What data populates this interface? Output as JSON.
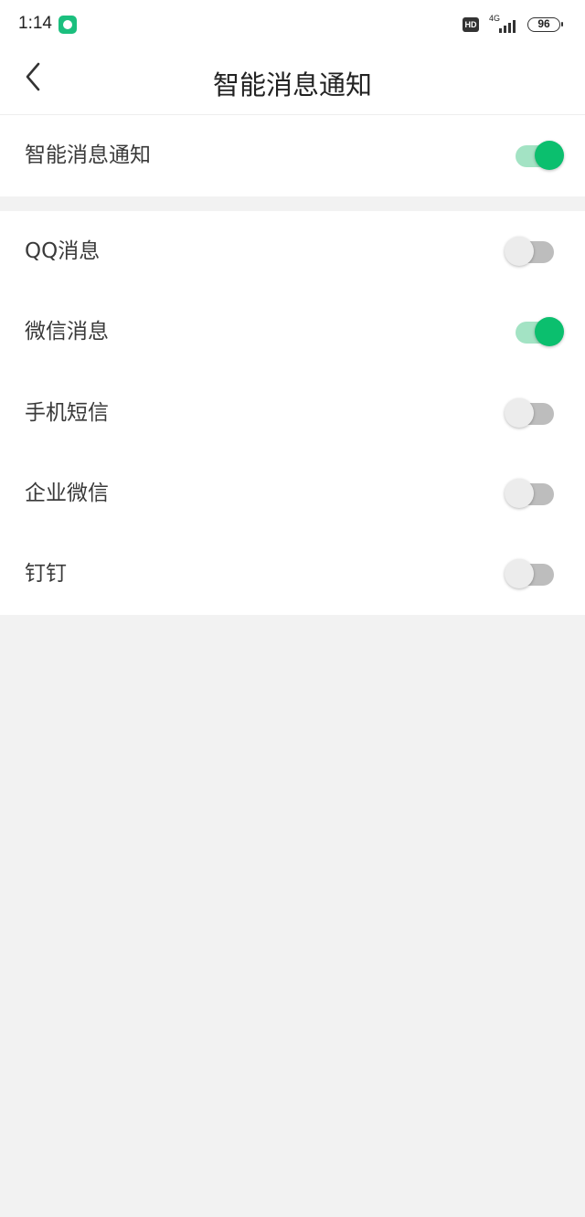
{
  "status_bar": {
    "time": "1:14",
    "hd_label": "HD",
    "network_label": "4G",
    "battery_level": "96",
    "app_icon": "app-notification-icon"
  },
  "nav": {
    "back_icon": "chevron-left-icon",
    "title": "智能消息通知"
  },
  "master_setting": {
    "label": "智能消息通知",
    "enabled": true
  },
  "sources": [
    {
      "label": "QQ消息",
      "enabled": false
    },
    {
      "label": "微信消息",
      "enabled": true
    },
    {
      "label": "手机短信",
      "enabled": false
    },
    {
      "label": "企业微信",
      "enabled": false
    },
    {
      "label": "钉钉",
      "enabled": false
    }
  ],
  "colors": {
    "accent": "#0bbf6e",
    "accent_track": "#a3e3c4",
    "off_track": "#bdbdbd",
    "off_knob": "#ececec",
    "background": "#f2f2f2"
  }
}
